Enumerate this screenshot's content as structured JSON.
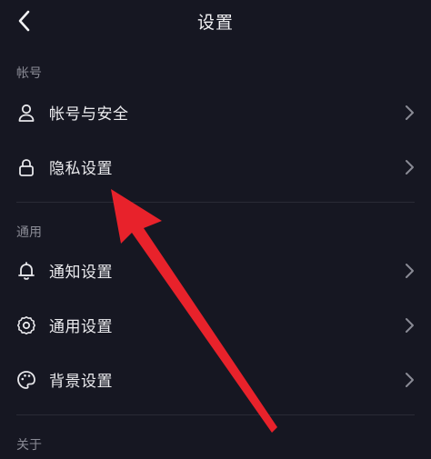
{
  "header": {
    "title": "设置"
  },
  "sections": {
    "account": {
      "label": "帐号",
      "items": [
        {
          "label": "帐号与安全",
          "icon": "user-icon"
        },
        {
          "label": "隐私设置",
          "icon": "lock-icon"
        }
      ]
    },
    "general": {
      "label": "通用",
      "items": [
        {
          "label": "通知设置",
          "icon": "bell-icon"
        },
        {
          "label": "通用设置",
          "icon": "gear-icon"
        },
        {
          "label": "背景设置",
          "icon": "palette-icon"
        }
      ]
    },
    "about": {
      "label": "关于"
    }
  },
  "colors": {
    "background": "#161722",
    "text": "#ececef",
    "section_label": "#8a8b95",
    "annotation_arrow": "#e8222b"
  }
}
